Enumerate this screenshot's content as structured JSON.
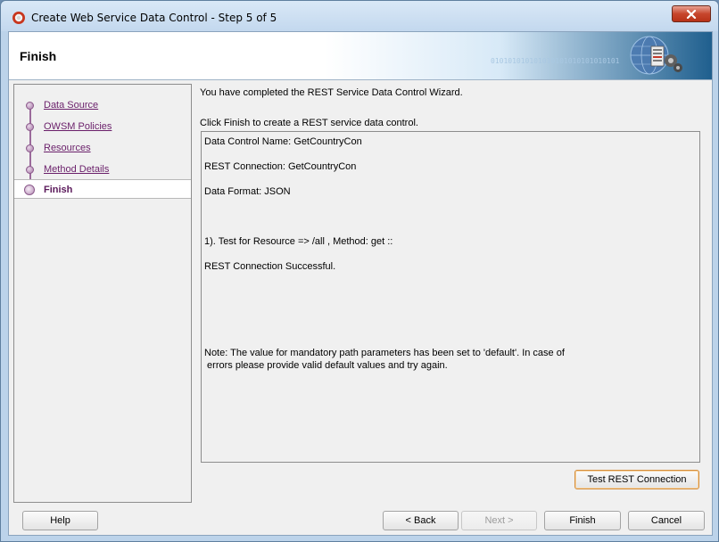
{
  "window": {
    "title": "Create Web Service Data Control - Step 5 of 5"
  },
  "header": {
    "title": "Finish",
    "binary_pattern": "010101010101010101010101010101"
  },
  "steps": [
    {
      "label": "Data Source",
      "current": false
    },
    {
      "label": "OWSM Policies",
      "current": false
    },
    {
      "label": "Resources",
      "current": false
    },
    {
      "label": "Method Details",
      "current": false
    },
    {
      "label": "Finish",
      "current": true
    }
  ],
  "main": {
    "completed_message": "You have completed the REST Service Data Control Wizard.",
    "instruction": "Click Finish to create a REST service data control.",
    "results": {
      "data_control_name": "Data Control Name: GetCountryCon",
      "rest_connection": "REST Connection: GetCountryCon",
      "data_format": "Data Format: JSON",
      "test_line": "1). Test for Resource => /all , Method: get ::",
      "connection_status": "REST Connection Successful.",
      "note_line1": "Note: The value for mandatory path parameters has been set to 'default'. In case of",
      "note_line2": " errors please provide valid default values and try again."
    }
  },
  "buttons": {
    "test_rest_connection": "Test REST Connection",
    "help": "Help",
    "back": "< Back",
    "next": "Next >",
    "finish": "Finish",
    "cancel": "Cancel"
  }
}
